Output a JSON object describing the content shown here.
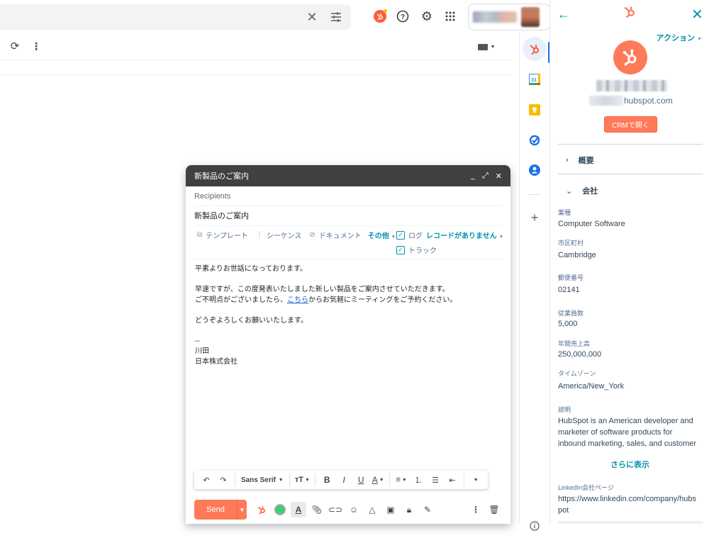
{
  "gmail": {
    "search_clear_icon": "close-icon",
    "search_options_icon": "tune-icon",
    "top_icons": [
      "hubspot-icon",
      "help-icon",
      "settings-icon",
      "apps-icon"
    ],
    "toolbar_icons": [
      "refresh-icon",
      "more-vert-icon"
    ],
    "input_tools_icon": "keyboard-icon"
  },
  "rail": {
    "items": [
      "hubspot",
      "calendar",
      "keep",
      "tasks",
      "contacts"
    ],
    "add_label": "+",
    "info_icon": "info-icon"
  },
  "compose": {
    "title": "新製品のご案内",
    "recipients_placeholder": "Recipients",
    "subject": "新製品のご案内",
    "hubspot_tools": {
      "template": "テンプレート",
      "sequence": "シーケンス",
      "document": "ドキュメント",
      "more": "その他",
      "log_label": "ログ",
      "log_record": "レコードがありません",
      "log_checked": true,
      "track_label": "トラック",
      "track_checked": true
    },
    "body": {
      "line1": "平素よりお世話になっております。",
      "line2": "早速ですが、この度発表いたしました新しい製品をご案内させていただきます。",
      "line3_pre": "ご不明点がございましたら、",
      "line3_link": "こちら",
      "line3_post": "からお気軽にミーティングをご予約ください。",
      "line4": "どうぞよろしくお願いいたします。",
      "sig_dash": "--",
      "sig_name": "川田",
      "sig_company": "日本株式会社"
    },
    "format": {
      "font": "Sans Serif",
      "bold": "B",
      "italic": "I",
      "underline": "U",
      "text_color": "A"
    },
    "send_label": "Send"
  },
  "hubspot_panel": {
    "actions_label": "アクション",
    "domain_suffix": "hubspot.com",
    "crm_button": "CRMで開く",
    "sections": {
      "overview": "概要",
      "company": "会社"
    },
    "properties": [
      {
        "label": "業種",
        "value": "Computer Software"
      },
      {
        "label": "市区町村",
        "value": "Cambridge"
      },
      {
        "label": "郵便番号",
        "value": "02141"
      },
      {
        "label": "従業員数",
        "value": "5,000"
      },
      {
        "label": "年間売上高",
        "value": "250,000,000"
      },
      {
        "label": "タイムゾーン",
        "value": "America/New_York"
      },
      {
        "label": "説明",
        "value": "HubSpot is an American developer and marketer of software products for inbound marketing, sales, and customer"
      }
    ],
    "show_more": "さらに表示",
    "linkedin_label": "LinkedIn会社ページ",
    "linkedin_value": "https://www.linkedin.com/company/hubspot"
  },
  "colors": {
    "hubspot_orange": "#ff7a59",
    "hubspot_teal": "#0091ae",
    "compose_header": "#404040"
  }
}
